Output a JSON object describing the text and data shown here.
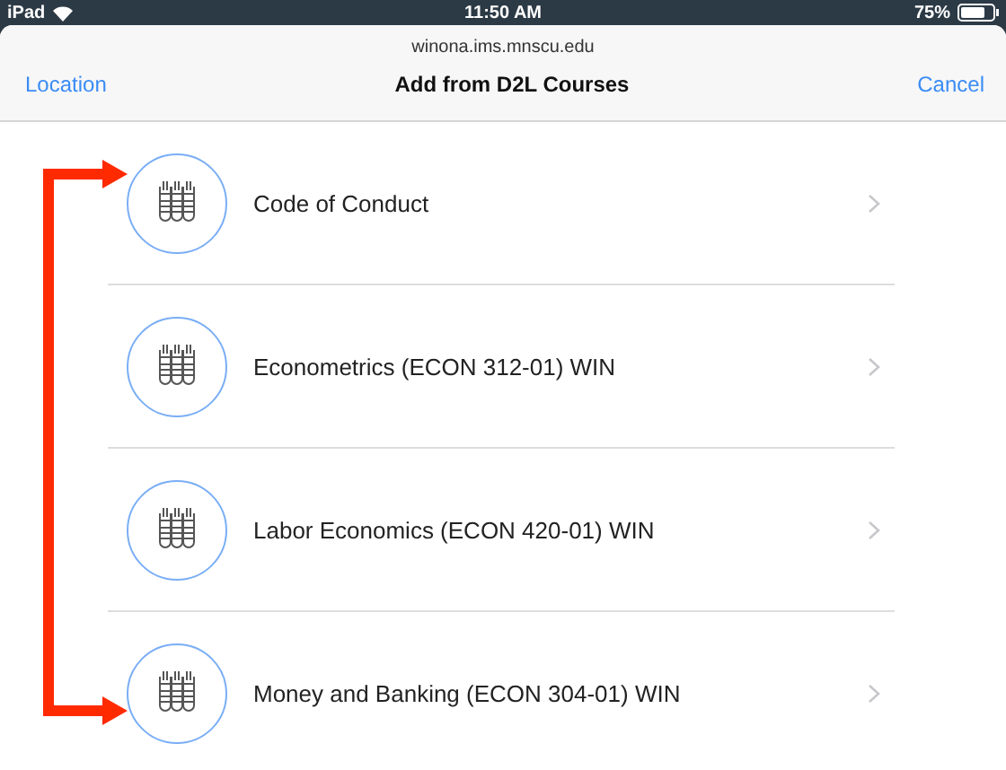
{
  "status_bar": {
    "device": "iPad",
    "time": "11:50 AM",
    "battery": "75%"
  },
  "sheet": {
    "url": "winona.ims.mnscu.edu",
    "title": "Add from D2L Courses",
    "left_button": "Location",
    "right_button": "Cancel"
  },
  "courses": [
    {
      "name": "Code of Conduct"
    },
    {
      "name": "Econometrics (ECON 312-01) WIN"
    },
    {
      "name": "Labor Economics (ECON 420-01) WIN"
    },
    {
      "name": "Money and Banking (ECON 304-01) WIN"
    }
  ]
}
